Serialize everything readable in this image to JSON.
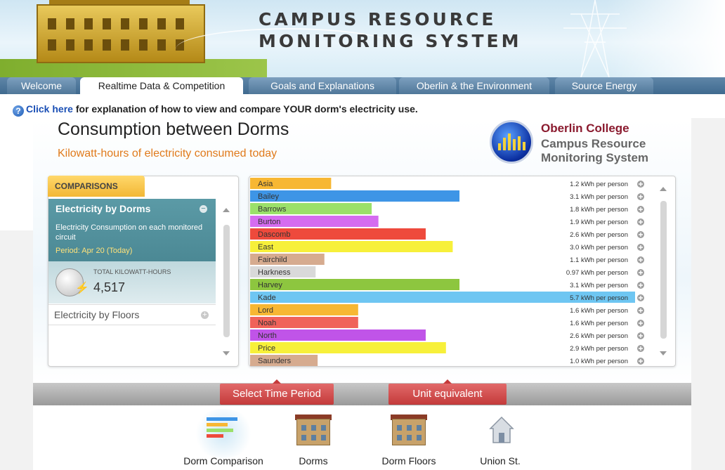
{
  "banner": {
    "title_line1": "CAMPUS RESOURCE",
    "title_line2": "MONITORING SYSTEM"
  },
  "tabs": [
    {
      "label": "Welcome",
      "active": false
    },
    {
      "label": "Realtime Data & Competition",
      "active": true
    },
    {
      "label": "Goals and Explanations",
      "active": false
    },
    {
      "label": "Oberlin & the Environment",
      "active": false
    },
    {
      "label": "Source Energy",
      "active": false
    }
  ],
  "help": {
    "icon": "question-icon",
    "link_text": "Click here",
    "rest_text": " for explanation of how to view and compare YOUR dorm's electricity use."
  },
  "page": {
    "title": "Consumption between Dorms",
    "subtitle": "Kilowatt-hours of electricity consumed today"
  },
  "logo": {
    "line1": "Oberlin College",
    "line2": "Campus Resource",
    "line3": "Monitoring System"
  },
  "left_panel": {
    "tab_label": "COMPARISONS",
    "section_title": "Electricity by Dorms",
    "section_desc": "Electricity Consumption on each monitored circuit",
    "period": "Period: Apr 20 (Today)",
    "total_label": "TOTAL KILOWATT-HOURS",
    "total_value": "4,517",
    "floors_label": "Electricity by Floors"
  },
  "chart_data": {
    "type": "bar",
    "orientation": "horizontal",
    "unit_suffix": "kWh per person",
    "categories": [
      "Asia",
      "Bailey",
      "Barrows",
      "Burton",
      "Dascomb",
      "East",
      "Fairchild",
      "Harkness",
      "Harvey",
      "Kade",
      "Lord",
      "Noah",
      "North",
      "Price",
      "Saunders"
    ],
    "values": [
      1.2,
      3.1,
      1.8,
      1.9,
      2.6,
      3.0,
      1.1,
      0.97,
      3.1,
      5.7,
      1.6,
      1.6,
      2.6,
      2.9,
      1.0
    ],
    "value_labels": [
      "1.2 kWh per person",
      "3.1 kWh per person",
      "1.8 kWh per person",
      "1.9 kWh per person",
      "2.6 kWh per person",
      "3.0 kWh per person",
      "1.1 kWh per person",
      "0.97 kWh per person",
      "3.1 kWh per person",
      "5.7 kWh per person",
      "1.6 kWh per person",
      "1.6 kWh per person",
      "2.6 kWh per person",
      "2.9 kWh per person",
      "1.0 kWh per person"
    ],
    "colors": [
      "#f7b733",
      "#3e95e6",
      "#9be06a",
      "#d56cf0",
      "#ee4a3c",
      "#f7f03a",
      "#d6ab8f",
      "#d9d9d9",
      "#8dc63f",
      "#6ec6f2",
      "#f7b733",
      "#f0625a",
      "#c054e8",
      "#f7f03a",
      "#d6ab8f"
    ],
    "xlim": [
      0,
      5.7
    ]
  },
  "bottom_bar": {
    "select_time": "Select Time Period",
    "unit_equiv": "Unit equivalent"
  },
  "bottom_nav": [
    {
      "label": "Dorm Comparison",
      "icon": "dorm-comparison-icon",
      "active": true
    },
    {
      "label": "Dorms",
      "icon": "dorms-building-icon",
      "active": false
    },
    {
      "label": "Dorm Floors",
      "icon": "dorm-floors-building-icon",
      "active": false
    },
    {
      "label": "Union St.",
      "icon": "house-icon",
      "active": false
    }
  ]
}
